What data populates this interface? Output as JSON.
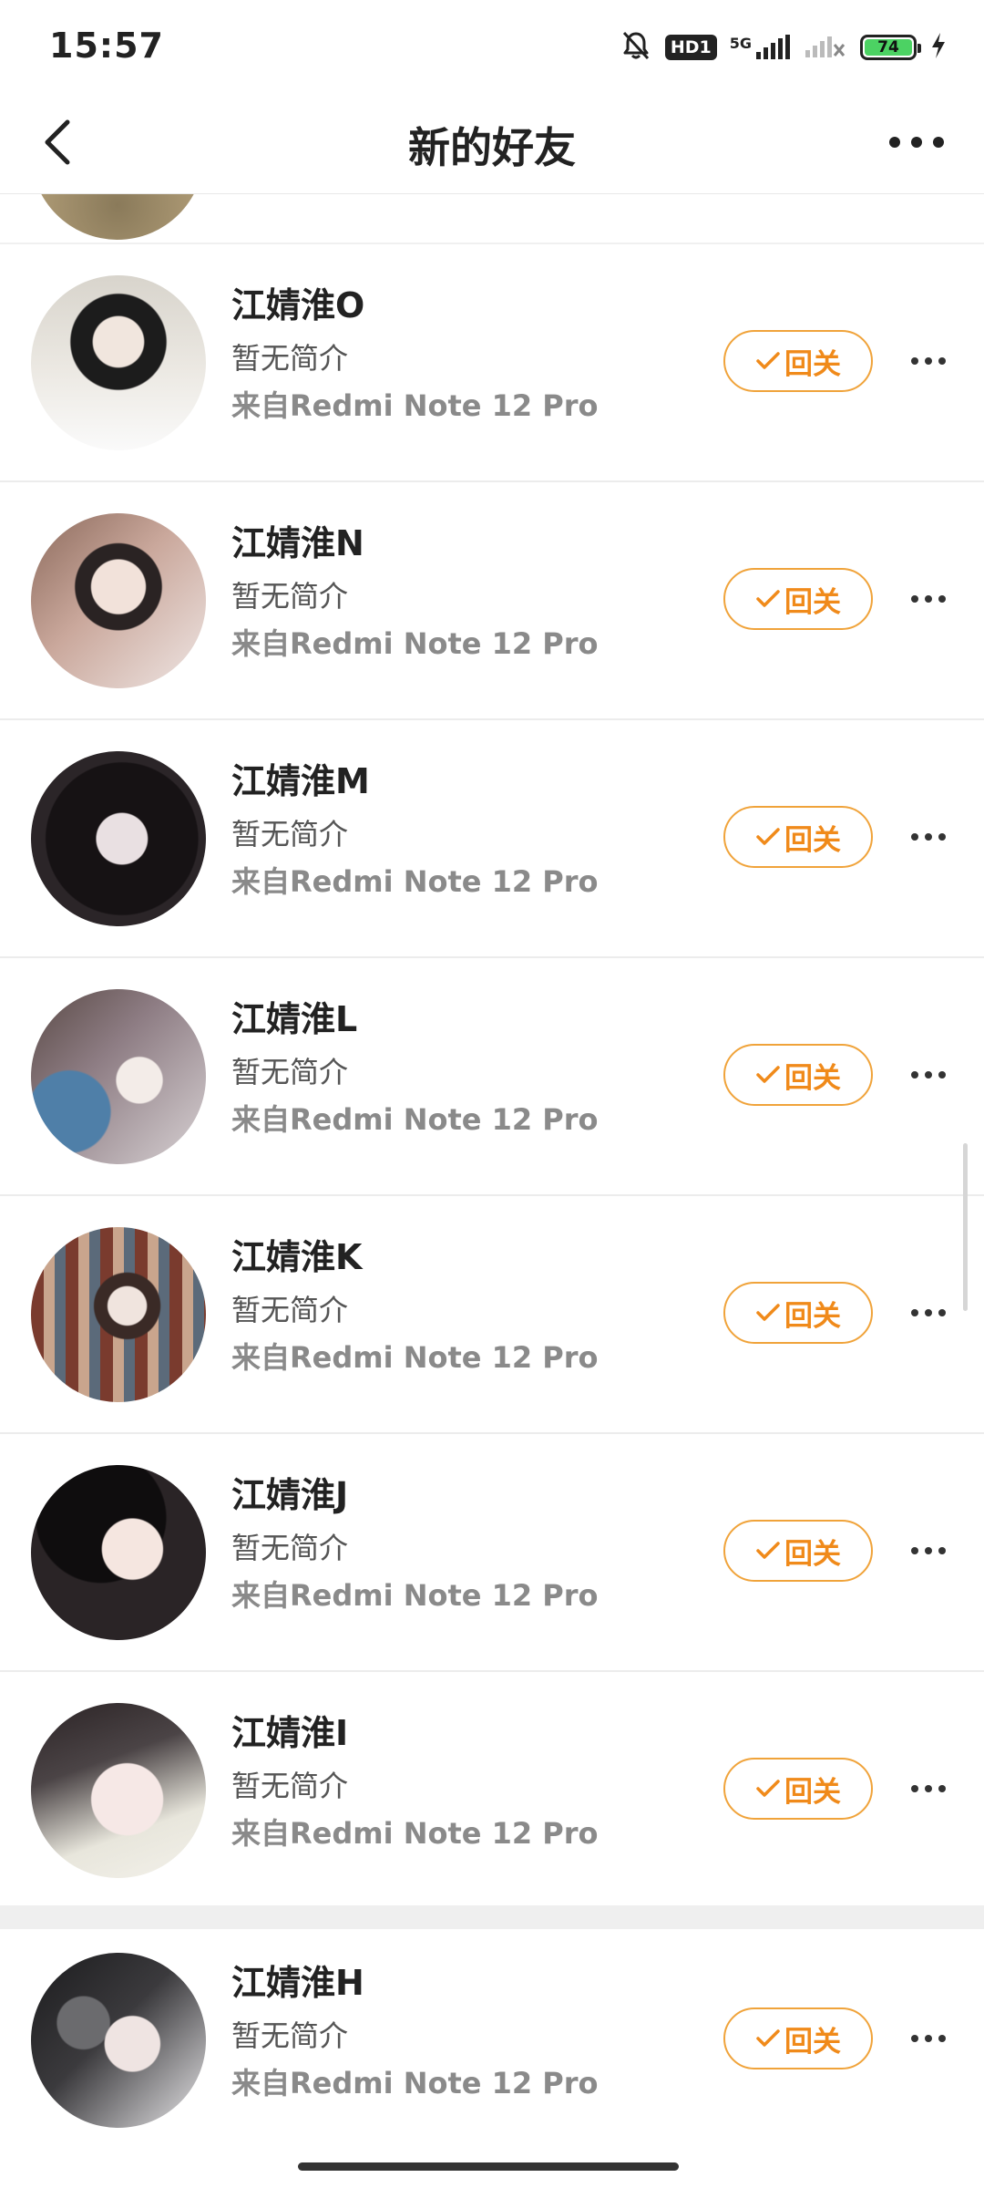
{
  "status_bar": {
    "time": "15:57",
    "hd_label": "HD1",
    "network_label": "5G",
    "battery": "74"
  },
  "header": {
    "title": "新的好友"
  },
  "follow_label": "回关",
  "rows": [
    {
      "name": "江婧淮O",
      "bio": "暂无简介",
      "source": "来自Redmi Note 12 Pro"
    },
    {
      "name": "江婧淮N",
      "bio": "暂无简介",
      "source": "来自Redmi Note 12 Pro"
    },
    {
      "name": "江婧淮M",
      "bio": "暂无简介",
      "source": "来自Redmi Note 12 Pro"
    },
    {
      "name": "江婧淮L",
      "bio": "暂无简介",
      "source": "来自Redmi Note 12 Pro"
    },
    {
      "name": "江婧淮K",
      "bio": "暂无简介",
      "source": "来自Redmi Note 12 Pro"
    },
    {
      "name": "江婧淮J",
      "bio": "暂无简介",
      "source": "来自Redmi Note 12 Pro"
    },
    {
      "name": "江婧淮I",
      "bio": "暂无简介",
      "source": "来自Redmi Note 12 Pro"
    },
    {
      "name": "江婧淮H",
      "bio": "暂无简介",
      "source": "来自Redmi Note 12 Pro"
    }
  ],
  "colors": {
    "accent": "#f08a1a",
    "accent_border": "#f0a33a",
    "battery_green": "#4cd263"
  }
}
